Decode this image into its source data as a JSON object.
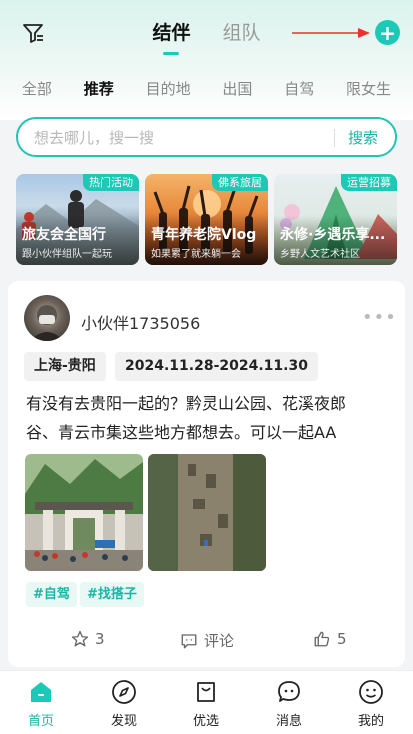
{
  "header": {
    "tabs": [
      {
        "label": "结伴",
        "active": true
      },
      {
        "label": "组队",
        "active": false
      }
    ],
    "filter_icon": "filter-icon",
    "add_icon": "plus-icon",
    "add_label": "+"
  },
  "categories": [
    "全部",
    "推荐",
    "目的地",
    "出国",
    "自驾",
    "限女生"
  ],
  "active_category": "推荐",
  "search": {
    "placeholder": "想去哪儿，搜一搜",
    "button": "搜索"
  },
  "featured": [
    {
      "badge": "热门活动",
      "title": "旅友会全国行",
      "subtitle": "跟小伙伴组队一起玩"
    },
    {
      "badge": "佛系旅居",
      "title": "青年养老院Vlog",
      "subtitle": "如果累了就来躺一会"
    },
    {
      "badge": "运营招募",
      "title": "永修·乡遇乐享...",
      "subtitle": "乡野人文艺术社区"
    }
  ],
  "post": {
    "username": "小伙伴1735056",
    "more": "•••",
    "route": "上海-贵阳",
    "dates": "2024.11.28-2024.11.30",
    "text": "有没有去贵阳一起的？黔灵山公园、花溪夜郎谷、青云市集这些地方都想去。可以一起AA",
    "hashtags": [
      "#自驾",
      "#找搭子"
    ],
    "likes_star": "3",
    "comment_label": "评论",
    "thumbs": "5"
  },
  "nav": [
    {
      "label": "首页",
      "icon": "home-icon",
      "active": true
    },
    {
      "label": "发现",
      "icon": "compass-icon",
      "active": false
    },
    {
      "label": "优选",
      "icon": "shopping-bag-icon",
      "active": false
    },
    {
      "label": "消息",
      "icon": "message-icon",
      "active": false
    },
    {
      "label": "我的",
      "icon": "smiley-icon",
      "active": false
    }
  ],
  "colors": {
    "accent": "#1ec8b6",
    "annotation_arrow": "#e8332a"
  }
}
